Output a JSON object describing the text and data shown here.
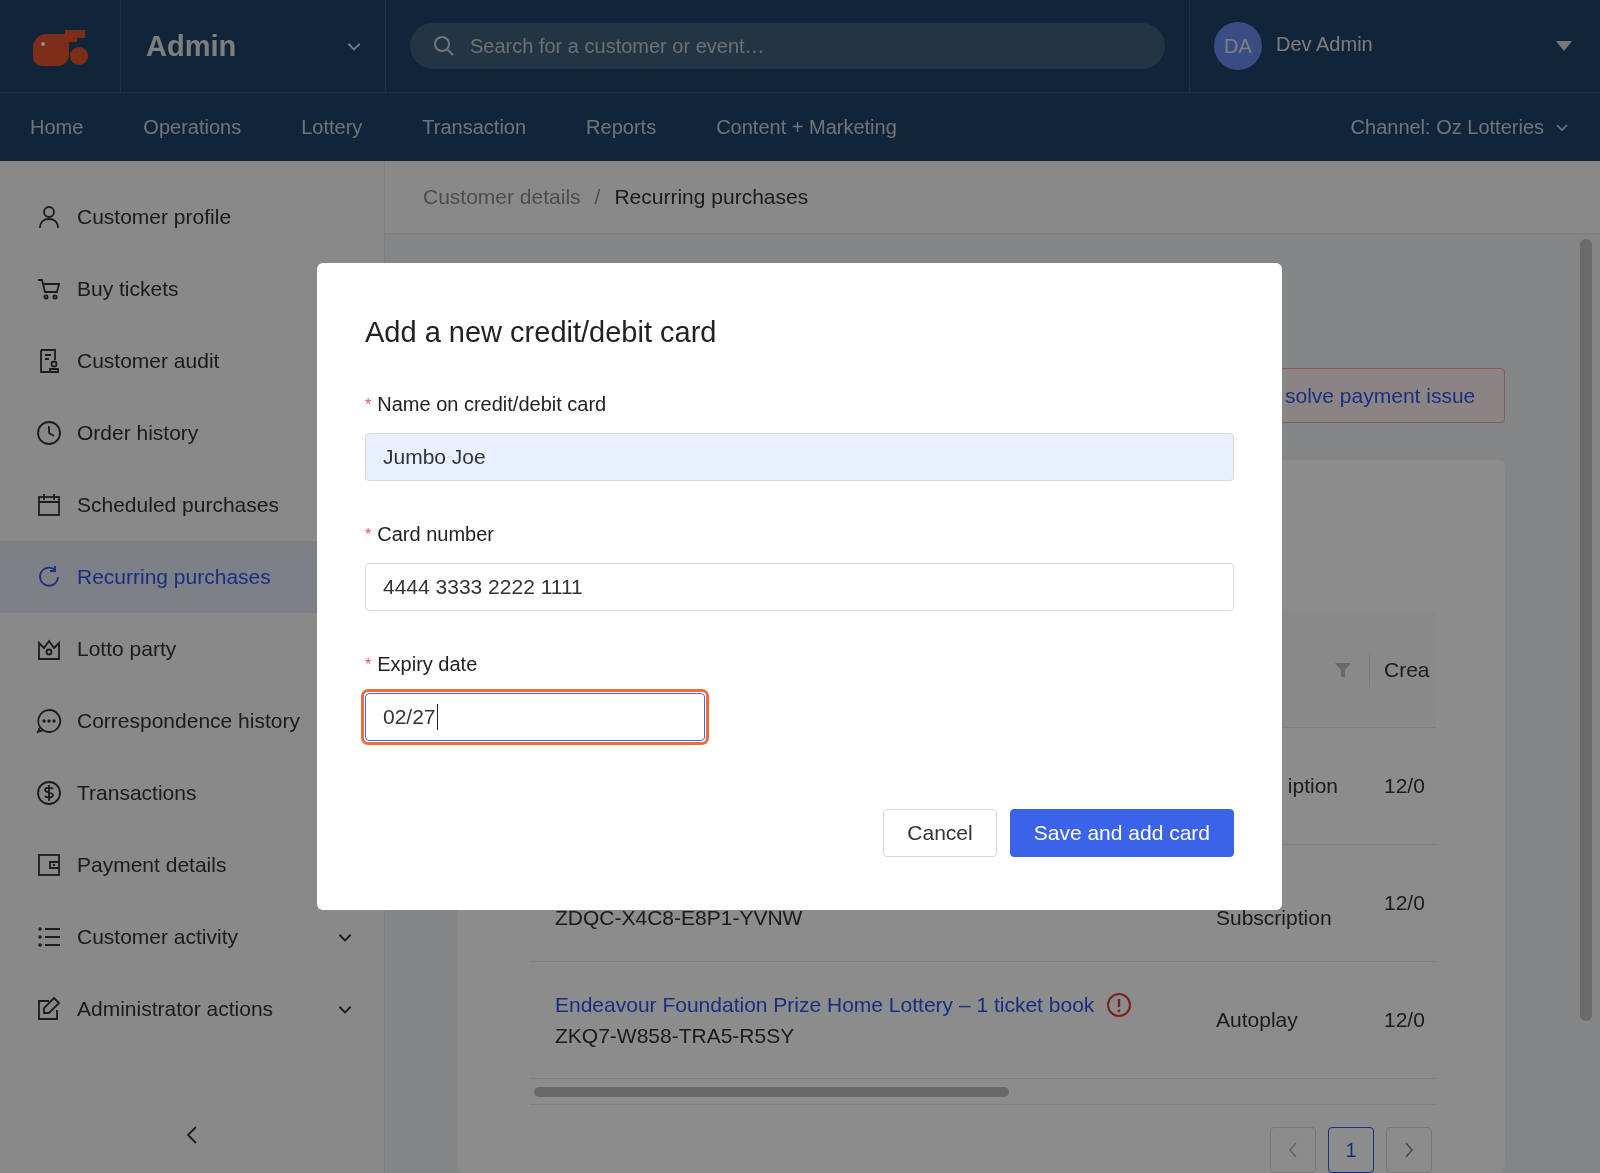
{
  "header": {
    "app_title": "Admin",
    "search": {
      "placeholder": "Search for a customer or event…"
    },
    "user": {
      "initials": "DA",
      "name": "Dev Admin"
    }
  },
  "nav": {
    "items": [
      {
        "label": "Home"
      },
      {
        "label": "Operations"
      },
      {
        "label": "Lottery"
      },
      {
        "label": "Transaction"
      },
      {
        "label": "Reports"
      },
      {
        "label": "Content + Marketing"
      }
    ],
    "channel": "Channel: Oz Lotteries"
  },
  "sidebar": {
    "items": [
      {
        "label": "Customer profile",
        "selected": false,
        "expandable": false
      },
      {
        "label": "Buy tickets",
        "selected": false,
        "expandable": false
      },
      {
        "label": "Customer audit",
        "selected": false,
        "expandable": false
      },
      {
        "label": "Order history",
        "selected": false,
        "expandable": false
      },
      {
        "label": "Scheduled purchases",
        "selected": false,
        "expandable": false
      },
      {
        "label": "Recurring purchases",
        "selected": true,
        "expandable": false
      },
      {
        "label": "Lotto party",
        "selected": false,
        "expandable": false
      },
      {
        "label": "Correspondence history",
        "selected": false,
        "expandable": false
      },
      {
        "label": "Transactions",
        "selected": false,
        "expandable": false
      },
      {
        "label": "Payment details",
        "selected": false,
        "expandable": false
      },
      {
        "label": "Customer activity",
        "selected": false,
        "expandable": true
      },
      {
        "label": "Administrator actions",
        "selected": false,
        "expandable": true
      }
    ]
  },
  "breadcrumb": {
    "separator": "/",
    "items": [
      {
        "label": "Customer details",
        "current": false
      },
      {
        "label": "Recurring purchases",
        "current": true
      }
    ]
  },
  "alert_button": {
    "label": "solve payment issue"
  },
  "table": {
    "columns": [
      {
        "label": "Crea"
      }
    ],
    "rows": [
      {
        "type": "iption",
        "date": "12/0"
      },
      {
        "code": "ZDQC-X4C8-E8P1-YVNW",
        "type": "Subscription",
        "date": "12/0"
      },
      {
        "title": "Endeavour Foundation Prize Home Lottery – 1 ticket book",
        "warning": true,
        "code": "ZKQ7-W858-TRA5-R5SY",
        "type": "Autoplay",
        "date": "12/0"
      }
    ]
  },
  "pagination": {
    "pages": [
      {
        "label": "1",
        "selected": true
      }
    ]
  },
  "modal": {
    "title": "Add a new credit/debit card",
    "fields": [
      {
        "label": "Name on credit/debit card",
        "required_mark": "*",
        "value": "Jumbo Joe",
        "autofilled": true,
        "focused": false
      },
      {
        "label": "Card number",
        "required_mark": "*",
        "value": "4444 3333 2222 1111",
        "autofilled": false,
        "focused": false
      },
      {
        "label": "Expiry date",
        "required_mark": "*",
        "value": "02/27",
        "autofilled": false,
        "focused": true
      }
    ],
    "buttons": [
      {
        "label": "Cancel",
        "kind": "secondary"
      },
      {
        "label": "Save and add card",
        "kind": "primary"
      }
    ]
  }
}
